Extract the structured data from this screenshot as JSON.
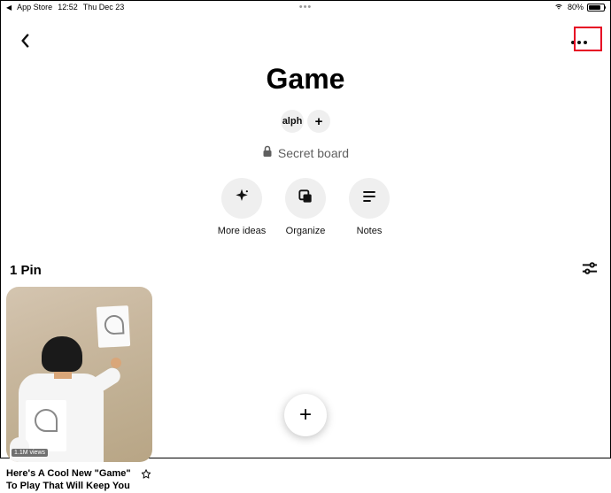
{
  "status": {
    "back_app": "App Store",
    "time": "12:52",
    "date": "Thu Dec 23",
    "battery_pct": "80%"
  },
  "board": {
    "title": "Game",
    "collaborator_initials": "alph",
    "secret_label": "Secret board"
  },
  "actions": {
    "ideas": "More ideas",
    "organize": "Organize",
    "notes": "Notes"
  },
  "pins": {
    "count_label": "1 Pin",
    "items": [
      {
        "title": "Here's A Cool New \"Game\" To Play That Will Keep You",
        "views_badge": "1.1M views"
      }
    ]
  }
}
